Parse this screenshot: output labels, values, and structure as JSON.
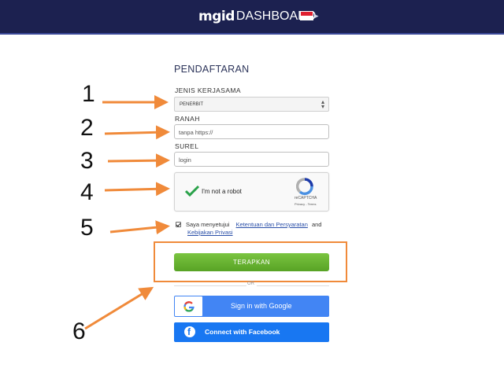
{
  "header": {
    "logo_brand": "mgid",
    "logo_product": "DASHBOARD",
    "flag_icon": "indonesia-flag-icon"
  },
  "form": {
    "title": "PENDAFTARAN",
    "partnership": {
      "label": "JENIS KERJASAMA",
      "selected": "PENERBIT"
    },
    "domain": {
      "label": "RANAH",
      "placeholder": "tanpa https://"
    },
    "email": {
      "label": "SUREL",
      "placeholder": "login"
    },
    "captcha": {
      "text": "I'm not a robot",
      "brand": "reCAPTCHA",
      "links": "Privacy - Terms"
    },
    "agreement": {
      "prefix": "Saya menyetujui",
      "terms_link": "Ketentuan dan Persyaratan",
      "and": "and",
      "privacy_link": "Kebijakan Privasi",
      "checked": true
    },
    "submit_label": "TERAPKAN",
    "or_label": "OR",
    "google_label": "Sign in with Google",
    "facebook_label": "Connect with Facebook"
  },
  "annotations": [
    "1",
    "2",
    "3",
    "4",
    "5",
    "6"
  ],
  "colors": {
    "header_bg": "#1c2150",
    "submit_green": "#6ab832",
    "google_blue": "#4285f4",
    "facebook_blue": "#1877f2",
    "annotation_orange": "#f08a3a"
  }
}
